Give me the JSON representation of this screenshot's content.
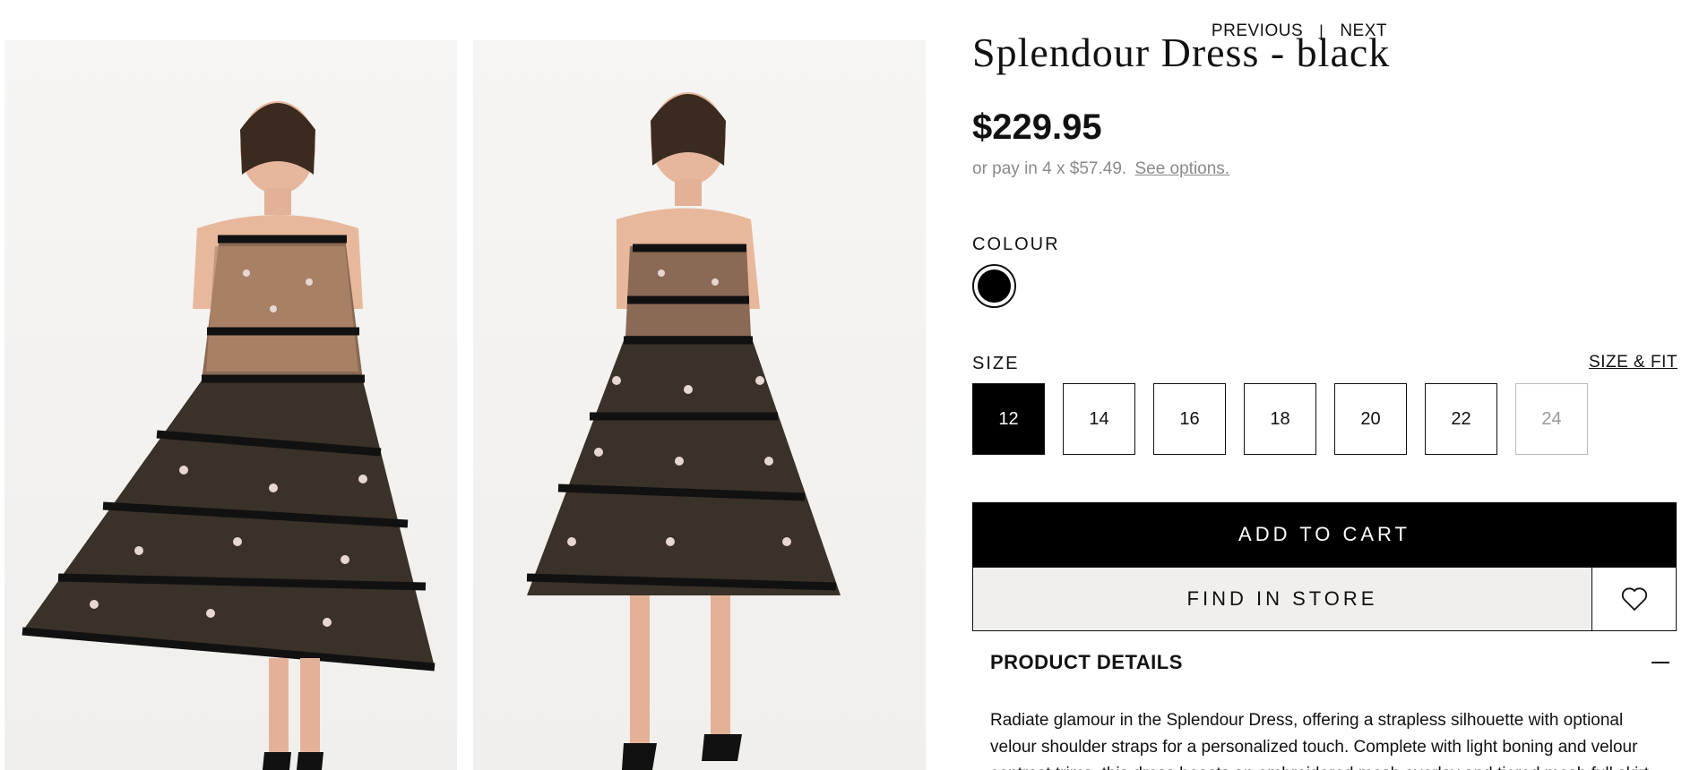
{
  "pager": {
    "previous": "PREVIOUS",
    "separator": "|",
    "next": "NEXT"
  },
  "product": {
    "title": "Splendour Dress - black",
    "price": "$229.95",
    "afterpay_text": "or pay in 4 x $57.49.",
    "afterpay_link": "See options."
  },
  "colour": {
    "label": "COLOUR",
    "selected_color": "#000000"
  },
  "size": {
    "label": "SIZE",
    "size_fit_link": "SIZE & FIT",
    "options": [
      {
        "label": "12",
        "state": "selected"
      },
      {
        "label": "14",
        "state": "available"
      },
      {
        "label": "16",
        "state": "available"
      },
      {
        "label": "18",
        "state": "available"
      },
      {
        "label": "20",
        "state": "available"
      },
      {
        "label": "22",
        "state": "available"
      },
      {
        "label": "24",
        "state": "unavailable"
      }
    ]
  },
  "actions": {
    "add_to_cart": "ADD TO CART",
    "find_in_store": "FIND IN STORE",
    "wishlist_icon": "heart-icon"
  },
  "details": {
    "heading": "PRODUCT DETAILS",
    "toggle_icon": "minus-icon",
    "description": "Radiate glamour in the Splendour Dress, offering a strapless silhouette with optional velour shoulder straps for a personalized touch. Complete with light boning and velour contrast trims, this dress boasts an embroidered mesh overlay and tiered mesh full skirt."
  }
}
